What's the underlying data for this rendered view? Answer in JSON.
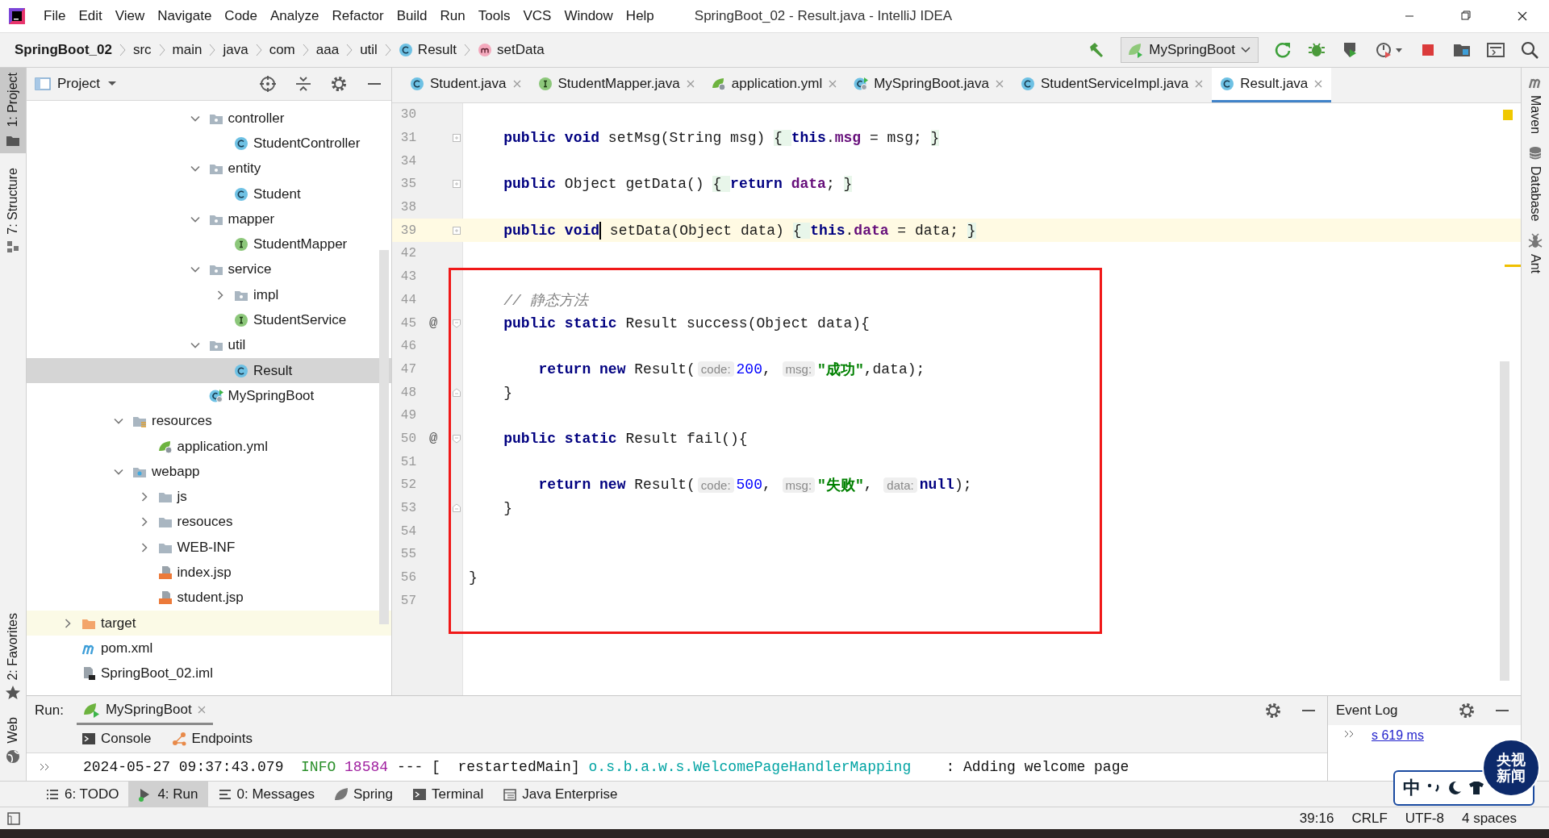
{
  "title_bar": {
    "menu": [
      "File",
      "Edit",
      "View",
      "Navigate",
      "Code",
      "Analyze",
      "Refactor",
      "Build",
      "Run",
      "Tools",
      "VCS",
      "Window",
      "Help"
    ],
    "title": "SpringBoot_02 - Result.java - IntelliJ IDEA"
  },
  "navigation_bar": {
    "breadcrumbs": [
      {
        "label": "SpringBoot_02",
        "kind": "project"
      },
      {
        "label": "src",
        "kind": "folder"
      },
      {
        "label": "main",
        "kind": "folder"
      },
      {
        "label": "java",
        "kind": "folder"
      },
      {
        "label": "com",
        "kind": "folder"
      },
      {
        "label": "aaa",
        "kind": "folder"
      },
      {
        "label": "util",
        "kind": "folder"
      },
      {
        "label": "Result",
        "kind": "class"
      },
      {
        "label": "setData",
        "kind": "method"
      }
    ],
    "run_configuration": "MySpringBoot"
  },
  "left_tool_strip": [
    {
      "label": "1: Project",
      "kind": "project",
      "selected": true
    },
    {
      "label": "7: Structure",
      "kind": "structure",
      "selected": false
    },
    {
      "label": "2: Favorites",
      "kind": "favorites",
      "selected": false
    },
    {
      "label": "Web",
      "kind": "web",
      "selected": false
    }
  ],
  "right_tool_strip": [
    {
      "label": "Maven",
      "kind": "maven"
    },
    {
      "label": "Database",
      "kind": "database"
    },
    {
      "label": "Ant",
      "kind": "ant"
    }
  ],
  "project_panel": {
    "title": "Project",
    "tree": [
      {
        "children": [
          {
            "children": [
              {
                "children": [
                  {
                    "children": [
                      {
                        "children": [
                          {
                            "label": "controller",
                            "kind": "package",
                            "expanded": true,
                            "selected": false,
                            "children": [
                              {
                                "label": "StudentController",
                                "kind": "class",
                                "selected": false
                              }
                            ]
                          },
                          {
                            "label": "entity",
                            "kind": "package",
                            "expanded": true,
                            "selected": false,
                            "children": [
                              {
                                "label": "Student",
                                "kind": "class",
                                "selected": false
                              }
                            ]
                          },
                          {
                            "label": "mapper",
                            "kind": "package",
                            "expanded": true,
                            "selected": false,
                            "children": [
                              {
                                "label": "StudentMapper",
                                "kind": "interface",
                                "selected": false
                              }
                            ]
                          },
                          {
                            "label": "service",
                            "kind": "package",
                            "expanded": true,
                            "selected": false,
                            "children": [
                              {
                                "label": "impl",
                                "kind": "package",
                                "expanded": false,
                                "selected": false
                              },
                              {
                                "label": "StudentService",
                                "kind": "interface",
                                "selected": false
                              }
                            ]
                          },
                          {
                            "label": "util",
                            "kind": "package",
                            "expanded": true,
                            "selected": false,
                            "children": [
                              {
                                "label": "Result",
                                "kind": "class",
                                "selected": true
                              }
                            ]
                          },
                          {
                            "label": "MySpringBoot",
                            "kind": "spring-class",
                            "selected": false
                          }
                        ]
                      }
                    ]
                  }
                ]
              },
              {
                "label": "resources",
                "kind": "resources",
                "expanded": true,
                "selected": false,
                "children": [
                  {
                    "label": "application.yml",
                    "kind": "yml",
                    "selected": false
                  }
                ]
              },
              {
                "label": "webapp",
                "kind": "webapp",
                "expanded": true,
                "selected": false,
                "children": [
                  {
                    "label": "js",
                    "kind": "folder",
                    "expanded": false,
                    "selected": false
                  },
                  {
                    "label": "resouces",
                    "kind": "folder",
                    "expanded": false,
                    "selected": false
                  },
                  {
                    "label": "WEB-INF",
                    "kind": "folder",
                    "expanded": false,
                    "selected": false
                  },
                  {
                    "label": "index.jsp",
                    "kind": "jsp",
                    "selected": false
                  },
                  {
                    "label": "student.jsp",
                    "kind": "jsp",
                    "selected": false
                  }
                ]
              }
            ]
          }
        ]
      },
      {
        "label": "target",
        "kind": "excluded",
        "expanded": false,
        "selected": false
      },
      {
        "label": "pom.xml",
        "kind": "maven",
        "selected": false
      },
      {
        "label": "SpringBoot_02.iml",
        "kind": "iml",
        "selected": false
      }
    ]
  },
  "editor": {
    "tabs": [
      {
        "label": "Student.java",
        "kind": "class",
        "selected": false
      },
      {
        "label": "StudentMapper.java",
        "kind": "interface",
        "selected": false
      },
      {
        "label": "application.yml",
        "kind": "yml",
        "selected": false
      },
      {
        "label": "MySpringBoot.java",
        "kind": "spring-class",
        "selected": false
      },
      {
        "label": "StudentServiceImpl.java",
        "kind": "class",
        "selected": false
      },
      {
        "label": "Result.java",
        "kind": "class",
        "selected": true
      }
    ],
    "lines": [
      {
        "number": "30",
        "current": false,
        "boxed": false
      },
      {
        "number": "31",
        "current": false,
        "boxed": false,
        "fold_marker": {
          "kind": "collapsed"
        },
        "tokens": [
          {
            "kind": "keyword",
            "text": "    public "
          },
          {
            "kind": "keyword",
            "text": "void"
          },
          {
            "kind": "plain",
            "text": " setMsg(String msg) "
          },
          {
            "kind": "folded",
            "text": "{ "
          },
          {
            "kind": "keyword",
            "text": "this"
          },
          {
            "kind": "plain",
            "text": "."
          },
          {
            "kind": "field",
            "text": "msg"
          },
          {
            "kind": "plain",
            "text": " = msg; "
          },
          {
            "kind": "folded",
            "text": "}"
          }
        ]
      },
      {
        "number": "34",
        "current": false,
        "boxed": false
      },
      {
        "number": "35",
        "current": false,
        "boxed": false,
        "fold_marker": {
          "kind": "collapsed"
        },
        "tokens": [
          {
            "kind": "keyword",
            "text": "    public"
          },
          {
            "kind": "plain",
            "text": " Object getData() "
          },
          {
            "kind": "folded",
            "text": "{ "
          },
          {
            "kind": "keyword",
            "text": "return "
          },
          {
            "kind": "field",
            "text": "data"
          },
          {
            "kind": "plain",
            "text": "; "
          },
          {
            "kind": "folded",
            "text": "}"
          }
        ]
      },
      {
        "number": "38",
        "current": false,
        "boxed": false
      },
      {
        "number": "39",
        "current": true,
        "boxed": false,
        "fold_marker": {
          "kind": "collapsed"
        },
        "tokens": [
          {
            "kind": "keyword",
            "text": "    public "
          },
          {
            "kind": "keyword",
            "text": "void"
          },
          {
            "kind": "caret"
          },
          {
            "kind": "plain",
            "text": " setData(Object data) "
          },
          {
            "kind": "folded",
            "text": "{ "
          },
          {
            "kind": "keyword",
            "text": "this"
          },
          {
            "kind": "plain",
            "text": "."
          },
          {
            "kind": "field",
            "text": "data"
          },
          {
            "kind": "plain",
            "text": " = data; "
          },
          {
            "kind": "folded",
            "text": "}"
          }
        ]
      },
      {
        "number": "42",
        "current": false,
        "boxed": false
      },
      {
        "number": "43",
        "current": false,
        "boxed": true
      },
      {
        "number": "44",
        "current": false,
        "boxed": true,
        "tokens": [
          {
            "kind": "comment",
            "text": "    // 静态方法"
          }
        ]
      },
      {
        "number": "45",
        "current": false,
        "boxed": true,
        "gutter_mark": "@",
        "fold_marker": {
          "kind": "start"
        },
        "tokens": [
          {
            "kind": "keyword",
            "text": "    public "
          },
          {
            "kind": "keyword",
            "text": "static"
          },
          {
            "kind": "plain",
            "text": " Result success(Object data){"
          }
        ]
      },
      {
        "number": "46",
        "current": false,
        "boxed": true
      },
      {
        "number": "47",
        "current": false,
        "boxed": true,
        "tokens": [
          {
            "kind": "keyword",
            "text": "        return "
          },
          {
            "kind": "keyword",
            "text": "new"
          },
          {
            "kind": "plain",
            "text": " Result("
          },
          {
            "kind": "hint",
            "text": "code:"
          },
          {
            "kind": "number",
            "text": "200"
          },
          {
            "kind": "plain",
            "text": ", "
          },
          {
            "kind": "hint",
            "text": "msg:"
          },
          {
            "kind": "string",
            "text": "\"成功\""
          },
          {
            "kind": "plain",
            "text": ",data);"
          }
        ]
      },
      {
        "number": "48",
        "current": false,
        "boxed": true,
        "fold_marker": {
          "kind": "end"
        },
        "tokens": [
          {
            "kind": "plain",
            "text": "    }"
          }
        ]
      },
      {
        "number": "49",
        "current": false,
        "boxed": true
      },
      {
        "number": "50",
        "current": false,
        "boxed": true,
        "gutter_mark": "@",
        "fold_marker": {
          "kind": "start"
        },
        "tokens": [
          {
            "kind": "keyword",
            "text": "    public "
          },
          {
            "kind": "keyword",
            "text": "static"
          },
          {
            "kind": "plain",
            "text": " Result fail(){"
          }
        ]
      },
      {
        "number": "51",
        "current": false,
        "boxed": true
      },
      {
        "number": "52",
        "current": false,
        "boxed": true,
        "tokens": [
          {
            "kind": "keyword",
            "text": "        return "
          },
          {
            "kind": "keyword",
            "text": "new"
          },
          {
            "kind": "plain",
            "text": " Result("
          },
          {
            "kind": "hint",
            "text": "code:"
          },
          {
            "kind": "number",
            "text": "500"
          },
          {
            "kind": "plain",
            "text": ", "
          },
          {
            "kind": "hint",
            "text": "msg:"
          },
          {
            "kind": "string",
            "text": "\"失败\""
          },
          {
            "kind": "plain",
            "text": ", "
          },
          {
            "kind": "hint",
            "text": "data:"
          },
          {
            "kind": "keyword",
            "text": "null"
          },
          {
            "kind": "plain",
            "text": ");"
          }
        ]
      },
      {
        "number": "53",
        "current": false,
        "boxed": true,
        "fold_marker": {
          "kind": "end"
        },
        "tokens": [
          {
            "kind": "plain",
            "text": "    }"
          }
        ]
      },
      {
        "number": "54",
        "current": false,
        "boxed": true
      },
      {
        "number": "55",
        "current": false,
        "boxed": true
      },
      {
        "number": "56",
        "current": false,
        "boxed": true,
        "tokens": [
          {
            "kind": "plain",
            "text": "}"
          }
        ]
      },
      {
        "number": "57",
        "current": false,
        "boxed": true
      }
    ]
  },
  "run_panel": {
    "label": "Run:",
    "tabs": [
      {
        "label": "MySpringBoot",
        "selected": true
      }
    ],
    "subtabs": [
      {
        "label": "Console",
        "kind": "console"
      },
      {
        "label": "Endpoints",
        "kind": "endpoints"
      }
    ],
    "console_lines": [
      [
        {
          "kind": "plain",
          "text": "2024-05-27 09:37:43.079  "
        },
        {
          "kind": "level",
          "text": "INFO"
        },
        {
          "kind": "pid",
          "text": " 18584"
        },
        {
          "kind": "plain",
          "text": " --- [  restartedMain] "
        },
        {
          "kind": "logger",
          "text": "o.s.b.a.w.s.WelcomePageHandlerMapping"
        },
        {
          "kind": "plain",
          "text": "    : Adding welcome page"
        }
      ]
    ]
  },
  "event_log": {
    "title": "Event Log",
    "link": "s 619 ms"
  },
  "tool_window_bar": [
    {
      "label": "6: TODO",
      "kind": "todo",
      "selected": false
    },
    {
      "label": "4: Run",
      "kind": "run",
      "selected": true
    },
    {
      "label": "0: Messages",
      "kind": "messages",
      "selected": false
    },
    {
      "label": "Spring",
      "kind": "spring",
      "selected": false
    },
    {
      "label": "Terminal",
      "kind": "terminal",
      "selected": false
    },
    {
      "label": "Java Enterprise",
      "kind": "enterprise",
      "selected": false
    }
  ],
  "status_bar": {
    "items": [
      "39:16",
      "CRLF",
      "UTF-8",
      "4 spaces"
    ]
  },
  "ime_bar": {
    "mode": "中"
  },
  "news_badge": {
    "lines": [
      "央视",
      "新闻"
    ]
  }
}
